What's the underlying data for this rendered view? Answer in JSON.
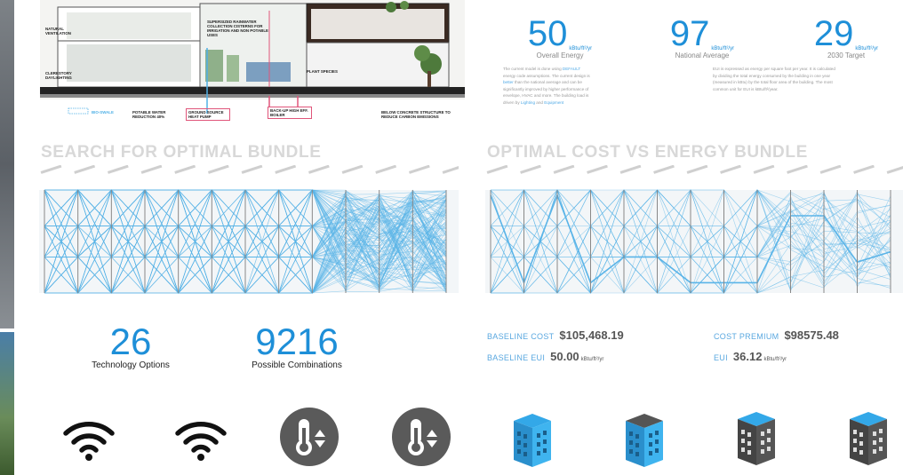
{
  "diagram": {
    "labels": {
      "natural_ventilation": "NATURAL VENTILATION",
      "rainwater": "SUPERSIZED RAINWATER COLLECTION CISTERNS FOR IRRIGATION AND NON POTABLE USES",
      "daylighting": "CLERESTORY DAYLIGHTING",
      "plants": "PLANT SPECIES",
      "bioswale": "BIO-SWALE",
      "potable_water": "POTABLE WATER REDUCTION 40%",
      "heat_pump": "GROUND SOURCE HEAT PUMP",
      "boiler": "BACK-UP HIGH EFF. BOILER",
      "concrete": "BELOW CONCRETE STRUCTURE TO REDUCE CARBON EMISSIONS"
    }
  },
  "kpis": [
    {
      "value": "50",
      "unit": "kBtu/ft²/yr",
      "label": "Overall Energy"
    },
    {
      "value": "97",
      "unit": "kBtu/ft²/yr",
      "label": "National Average"
    },
    {
      "value": "29",
      "unit": "kBtu/ft²/yr",
      "label": "2030 Target"
    }
  ],
  "paragraphs": {
    "left": [
      "The current model is done using",
      "DEFAULT",
      "energy code assumptions. The current design is",
      "better",
      "than the national average and can be significantly improved by higher performance of envelope, HVAC and more. The building load is driven by",
      "Lighting",
      "and",
      "Equipment"
    ],
    "right": "EUI is expressed as energy per square foot per year. It is calculated by dividing the total energy consumed by the building in one year (measured in kBtu) by the total floor area of the building. The most common unit for EUI is kBtu/ft²/year."
  },
  "headings": {
    "search": "SEARCH FOR OPTIMAL BUNDLE",
    "optimal": "OPTIMAL COST VS ENERGY BUNDLE"
  },
  "stats": [
    {
      "value": "26",
      "label": "Technology Options"
    },
    {
      "value": "9216",
      "label": "Possible Combinations"
    }
  ],
  "costs": {
    "baseline_cost": {
      "label": "BASELINE COST",
      "value": "$105,468.19"
    },
    "baseline_eui": {
      "label": "BASELINE EUI",
      "value": "50.00",
      "unit": "kBtu/ft²/yr"
    },
    "cost_premium": {
      "label": "COST PREMIUM",
      "value": "$98575.48"
    },
    "eui": {
      "label": "EUI",
      "value": "36.12",
      "unit": "kBtu/ft²/yr"
    }
  },
  "icons": [
    "wifi-icon",
    "wifi-icon",
    "thermostat-icon",
    "thermostat-icon",
    "building-icon",
    "building-icon",
    "building-icon",
    "building-icon"
  ],
  "colors": {
    "accent": "#1e8fd8",
    "line": "#5ab4e8",
    "heading": "#d8d8d8",
    "dark_icon": "#555555"
  }
}
